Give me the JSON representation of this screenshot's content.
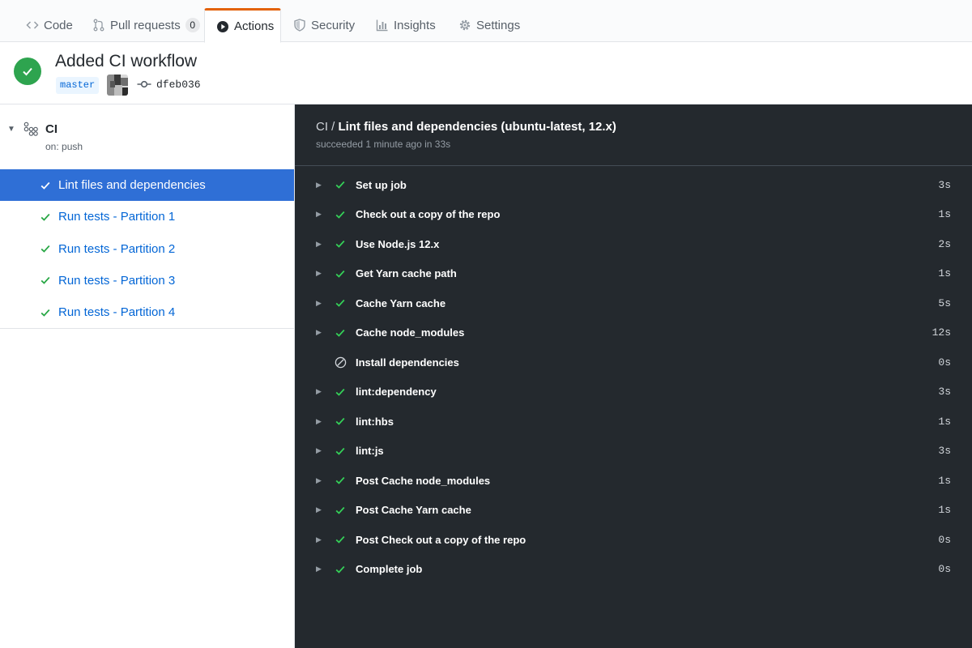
{
  "tabs": [
    {
      "label": "Code",
      "icon": "code-icon"
    },
    {
      "label": "Pull requests",
      "icon": "pull-request-icon",
      "count": "0"
    },
    {
      "label": "Actions",
      "icon": "play-icon",
      "selected": true
    },
    {
      "label": "Security",
      "icon": "shield-icon"
    },
    {
      "label": "Insights",
      "icon": "graph-icon"
    },
    {
      "label": "Settings",
      "icon": "gear-icon"
    }
  ],
  "run": {
    "title": "Added CI workflow",
    "branch": "master",
    "commit_sha": "dfeb036",
    "status": "success"
  },
  "workflow": {
    "name": "CI",
    "trigger": "on: push"
  },
  "jobs": [
    {
      "label": "Lint files and dependencies",
      "active": true
    },
    {
      "label": "Run tests - Partition 1"
    },
    {
      "label": "Run tests - Partition 2"
    },
    {
      "label": "Run tests - Partition 3"
    },
    {
      "label": "Run tests - Partition 4"
    }
  ],
  "log": {
    "workflow_prefix": "CI / ",
    "job_title": "Lint files and dependencies (ubuntu-latest, 12.x)",
    "subtitle": "succeeded 1 minute ago in 33s"
  },
  "steps": [
    {
      "name": "Set up job",
      "duration": "3s",
      "status": "success"
    },
    {
      "name": "Check out a copy of the repo",
      "duration": "1s",
      "status": "success"
    },
    {
      "name": "Use Node.js 12.x",
      "duration": "2s",
      "status": "success"
    },
    {
      "name": "Get Yarn cache path",
      "duration": "1s",
      "status": "success"
    },
    {
      "name": "Cache Yarn cache",
      "duration": "5s",
      "status": "success"
    },
    {
      "name": "Cache node_modules",
      "duration": "12s",
      "status": "success"
    },
    {
      "name": "Install dependencies",
      "duration": "0s",
      "status": "skipped"
    },
    {
      "name": "lint:dependency",
      "duration": "3s",
      "status": "success"
    },
    {
      "name": "lint:hbs",
      "duration": "1s",
      "status": "success"
    },
    {
      "name": "lint:js",
      "duration": "3s",
      "status": "success"
    },
    {
      "name": "Post Cache node_modules",
      "duration": "1s",
      "status": "success"
    },
    {
      "name": "Post Cache Yarn cache",
      "duration": "1s",
      "status": "success"
    },
    {
      "name": "Post Check out a copy of the repo",
      "duration": "0s",
      "status": "success"
    },
    {
      "name": "Complete job",
      "duration": "0s",
      "status": "success"
    }
  ],
  "colors": {
    "accent_orange": "#e36209",
    "success_green": "#2ea44f",
    "link_blue": "#0366d6",
    "active_blue": "#2f6fd6",
    "log_background": "#24292e"
  }
}
